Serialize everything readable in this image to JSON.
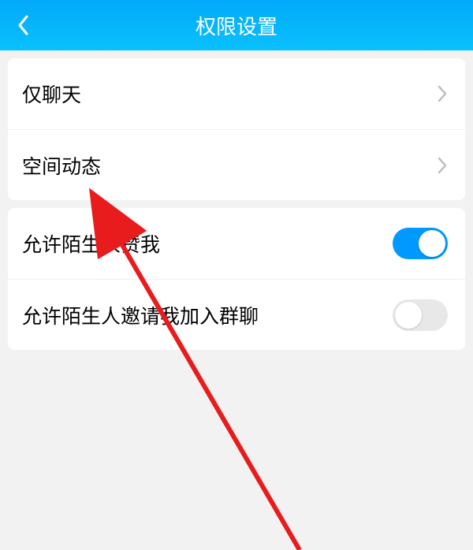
{
  "header": {
    "title": "权限设置"
  },
  "group1": {
    "items": [
      {
        "label": "仅聊天"
      },
      {
        "label": "空间动态"
      }
    ]
  },
  "group2": {
    "items": [
      {
        "label": "允许陌生人赞我",
        "toggle": true
      },
      {
        "label": "允许陌生人邀请我加入群聊",
        "toggle": false
      }
    ]
  }
}
